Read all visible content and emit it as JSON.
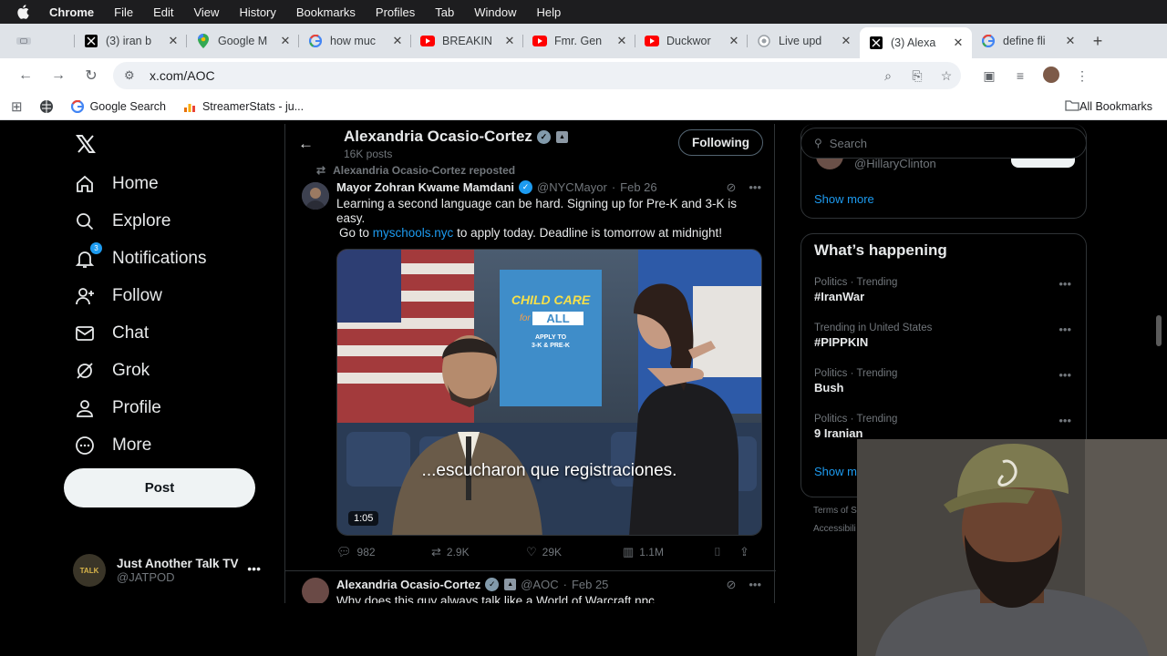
{
  "menubar": {
    "app": "Chrome",
    "items": [
      "File",
      "Edit",
      "View",
      "History",
      "Bookmarks",
      "Profiles",
      "Tab",
      "Window",
      "Help"
    ]
  },
  "tabs": [
    {
      "title": "",
      "icon": "grid-icon"
    },
    {
      "title": "(3) iran b",
      "icon": "x-icon"
    },
    {
      "title": "Google M",
      "icon": "maps-icon"
    },
    {
      "title": "how muc",
      "icon": "google-icon"
    },
    {
      "title": "BREAKIN",
      "icon": "youtube-icon"
    },
    {
      "title": "Fmr. Gen",
      "icon": "youtube-icon"
    },
    {
      "title": "Duckwor",
      "icon": "youtube-icon"
    },
    {
      "title": "Live upd",
      "icon": "globe-icon"
    },
    {
      "title": "(3) Alexa",
      "icon": "x-icon",
      "active": true
    },
    {
      "title": "define fli",
      "icon": "google-icon"
    }
  ],
  "address": {
    "url": "x.com/AOC"
  },
  "bookmarks": {
    "items": [
      {
        "label": "Google Search"
      },
      {
        "label": "StreamerStats - ju..."
      }
    ],
    "all_label": "All Bookmarks"
  },
  "nav": {
    "items": [
      {
        "label": "Home",
        "icon": "home-icon"
      },
      {
        "label": "Explore",
        "icon": "search-icon"
      },
      {
        "label": "Notifications",
        "icon": "bell-icon",
        "badge": "3"
      },
      {
        "label": "Follow",
        "icon": "add-person-icon"
      },
      {
        "label": "Chat",
        "icon": "mail-icon"
      },
      {
        "label": "Grok",
        "icon": "grok-icon"
      },
      {
        "label": "Profile",
        "icon": "person-icon"
      },
      {
        "label": "More",
        "icon": "more-circle-icon"
      }
    ],
    "post_label": "Post",
    "account": {
      "name": "Just Another Talk TV",
      "handle": "@JATPOD",
      "avatar_text": "TALK"
    }
  },
  "profile_header": {
    "name": "Alexandria Ocasio-Cortez",
    "posts": "16K posts",
    "following_label": "Following"
  },
  "tweet1": {
    "repost_label": "Alexandria Ocasio-Cortez reposted",
    "name": "Mayor Zohran Kwame Mamdani",
    "handle": "@NYCMayor",
    "sep": "·",
    "date": "Feb 26",
    "text_line1": "Learning a second language can be hard. Signing up for Pre-K and 3-K is easy.",
    "text_go": "Go to ",
    "link": "myschools.nyc",
    "text_after": " to apply today. Deadline is tomorrow at midnight!",
    "media": {
      "caption": "...escucharon que registraciones.",
      "duration": "1:05",
      "sign_line1": "CHILD CARE",
      "sign_line2": "for",
      "sign_line3": "ALL",
      "sign_line4": "APPLY TO",
      "sign_line5": "3-K & PRE-K"
    },
    "stats": {
      "replies": "982",
      "reposts": "2.9K",
      "likes": "29K",
      "views": "1.1M"
    }
  },
  "tweet2": {
    "name": "Alexandria Ocasio-Cortez",
    "handle": "@AOC",
    "sep": "·",
    "date": "Feb 25",
    "text": "Why does this guy always talk like a World of Warcraft npc"
  },
  "sidebar": {
    "search_placeholder": "Search",
    "wtf_handle": "@HillaryClinton",
    "show_more": "Show more",
    "happening_title": "What’s happening",
    "trends": [
      {
        "meta": "Politics · Trending",
        "name": "#IranWar"
      },
      {
        "meta": "Trending in United States",
        "name": "#PIPPKIN"
      },
      {
        "meta": "Politics · Trending",
        "name": "Bush"
      },
      {
        "meta": "Politics · Trending",
        "name": "9 Iranian"
      }
    ],
    "show_more_2": "Show m",
    "footer_1": "Terms of S",
    "footer_2": "Accessibili"
  },
  "colors": {
    "accent": "#1d9bf0",
    "background": "#000000",
    "border": "#2f3336",
    "muted": "#71767b"
  }
}
